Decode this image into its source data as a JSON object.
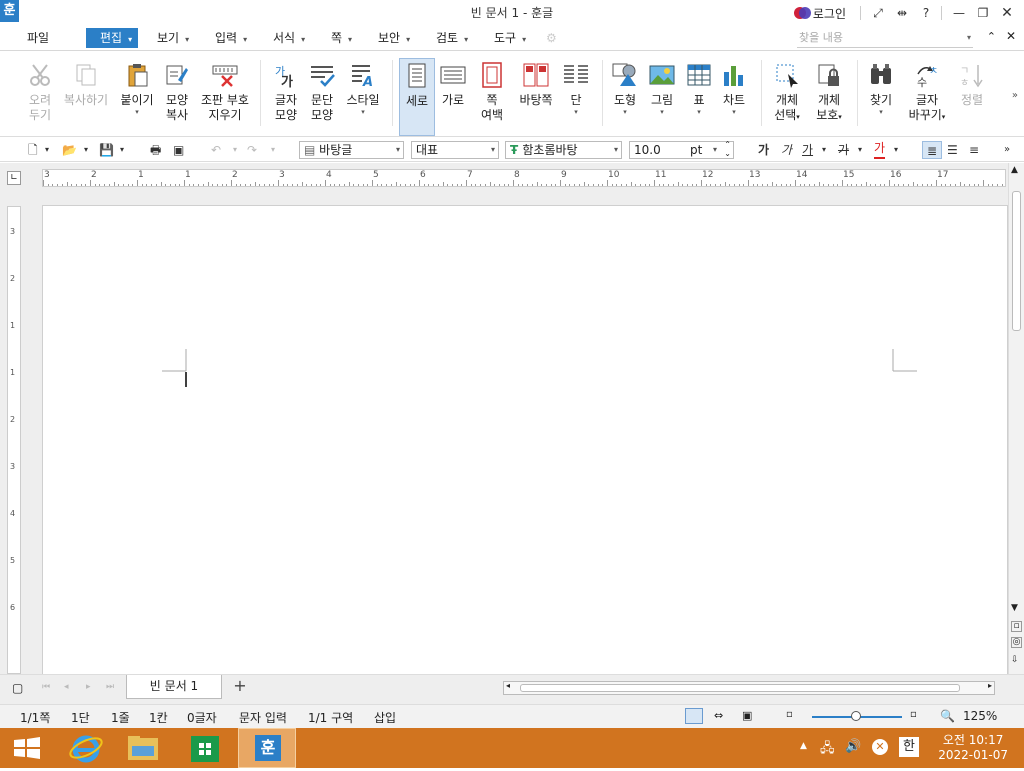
{
  "window": {
    "title": "빈 문서 1 - 훈글",
    "app_icon": "훈",
    "login": "로그인"
  },
  "menu": {
    "file": "파일",
    "edit": "편집",
    "view": "보기",
    "insert": "입력",
    "format": "서식",
    "page": "쪽",
    "security": "보안",
    "review": "검토",
    "tools": "도구",
    "find_placeholder": "찾을 내용"
  },
  "ribbon": {
    "cut": [
      "오려",
      "두기"
    ],
    "copy": "복사하기",
    "paste": "붙이기",
    "format_copy": [
      "모양",
      "복사"
    ],
    "clear_marks": [
      "조판 부호",
      "지우기"
    ],
    "char_shape": [
      "글자",
      "모양"
    ],
    "para_shape": [
      "문단",
      "모양"
    ],
    "style": "스타일",
    "portrait": "세로",
    "landscape": "가로",
    "margin": [
      "쪽",
      "여백"
    ],
    "background": "바탕쪽",
    "column": "단",
    "shape": "도형",
    "picture": "그림",
    "table": "표",
    "chart": "차트",
    "obj_select": [
      "개체",
      "선택"
    ],
    "obj_protect": [
      "개체",
      "보호"
    ],
    "find": "찾기",
    "replace": [
      "글자",
      "바꾸기"
    ],
    "sort": "정렬"
  },
  "toolbar": {
    "style": "바탕글",
    "lang": "대표",
    "font": "함초롬바탕",
    "size": "10.0",
    "unit": "pt",
    "bold": "가",
    "italic": "가",
    "underline": "가",
    "strike": "가",
    "color": "가"
  },
  "ruler": {
    "h_ticks": [
      "3",
      "2",
      "1",
      "1",
      "2",
      "3",
      "4",
      "5",
      "6",
      "7",
      "8",
      "9",
      "10",
      "11",
      "12",
      "13",
      "14",
      "15",
      "16",
      "17"
    ],
    "v_ticks": [
      "3",
      "2",
      "1",
      "1",
      "2",
      "3",
      "4",
      "5",
      "6"
    ]
  },
  "tabs": {
    "doc": "빈 문서 1",
    "add": "+"
  },
  "status": {
    "page": "1/1쪽",
    "column": "1단",
    "line": "1줄",
    "col": "1칸",
    "chars": "0글자",
    "mode": "문자 입력",
    "section": "1/1 구역",
    "insert": "삽입",
    "zoom": "125%"
  },
  "taskbar": {
    "time": "오전 10:17",
    "date": "2022-01-07",
    "ime": "한"
  }
}
